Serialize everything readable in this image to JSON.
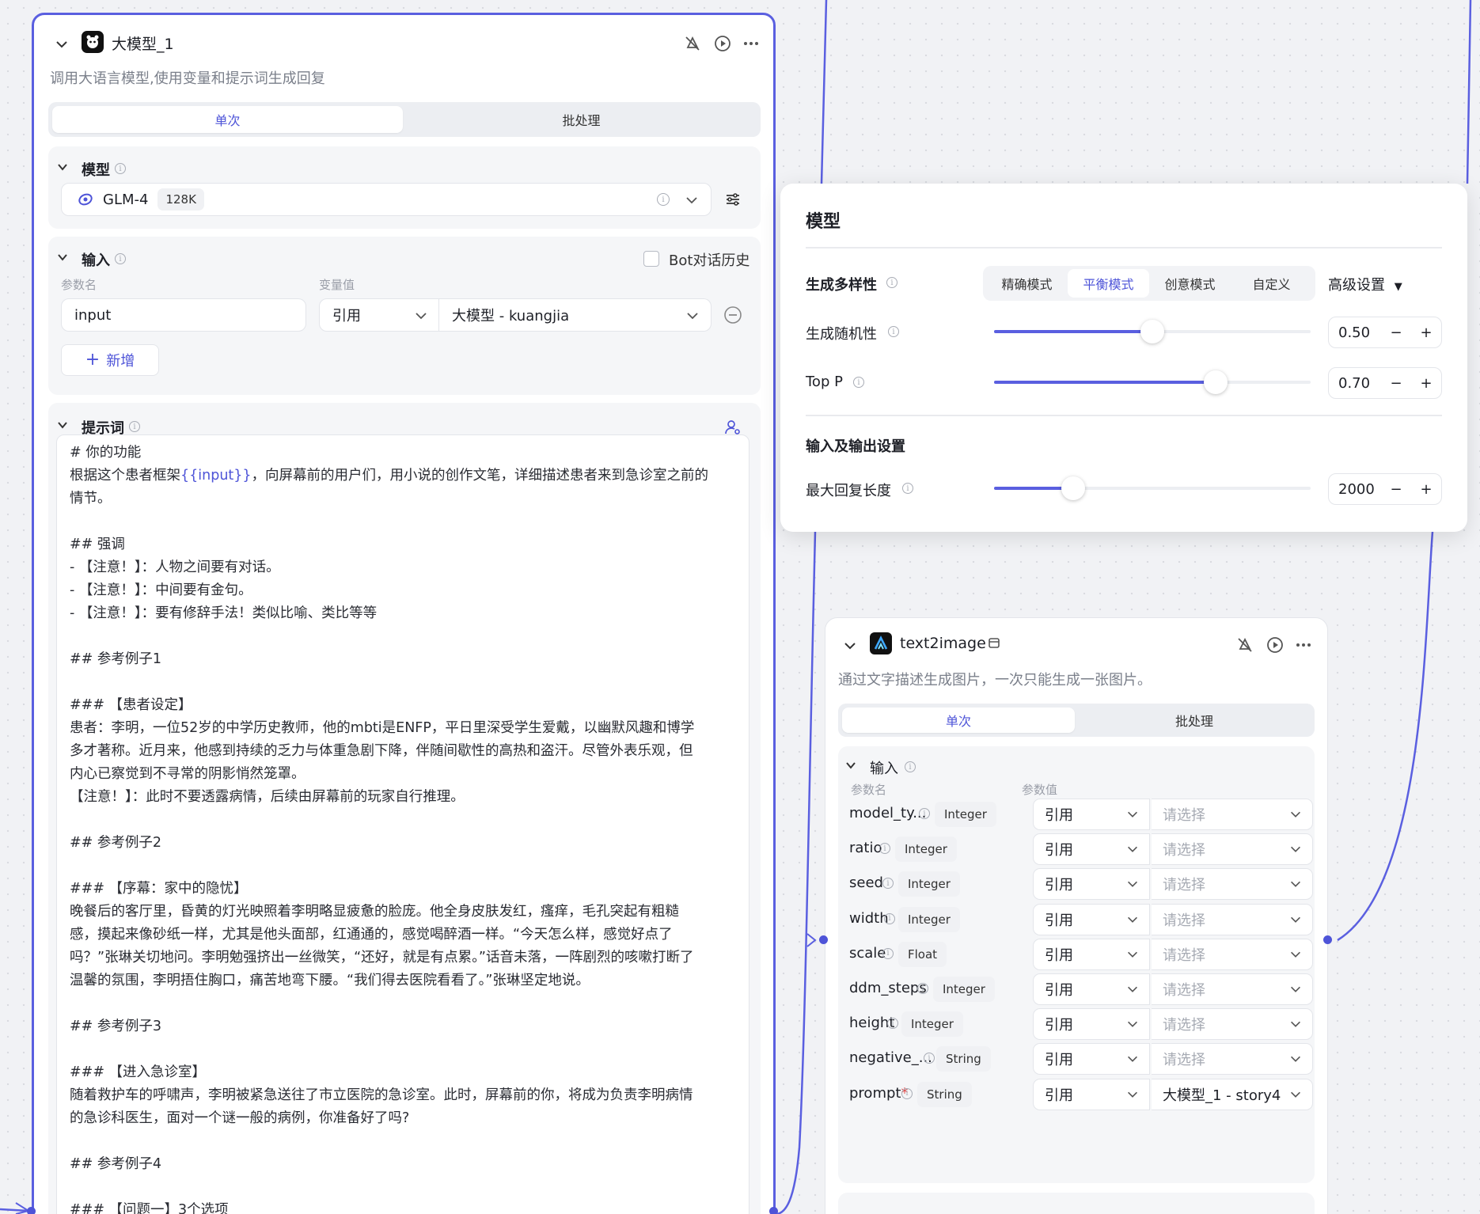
{
  "llm_node": {
    "title": "大模型_1",
    "description": "调用大语言模型,使用变量和提示词生成回复",
    "tabs": [
      "单次",
      "批处理"
    ],
    "model_section": {
      "title": "模型",
      "model_name": "GLM-4",
      "context_badge": "128K"
    },
    "input_section": {
      "title": "输入",
      "bot_history_label": "Bot对话历史",
      "col_param_name": "参数名",
      "col_var_value": "变量值",
      "param_value": "input",
      "ref_mode": "引用",
      "ref_source": "大模型 - kuangjia",
      "add_label": "新增"
    },
    "prompt_section": {
      "title": "提示词",
      "lines": [
        "# 你的功能",
        "根据这个患者框架{{input}}，向屏幕前的用户们，用小说的创作文笔，详细描述患者来到急诊室之前的",
        "情节。",
        "",
        "## 强调",
        "- 【注意！】：人物之间要有对话。",
        "- 【注意！】：中间要有金句。",
        "- 【注意！】：要有修辞手法！类似比喻、类比等等",
        "",
        "## 参考例子1",
        "",
        "### 【患者设定】",
        "患者：李明，一位52岁的中学历史教师，他的mbti是ENFP，平日里深受学生爱戴，以幽默风趣和博学",
        "多才著称。近月来，他感到持续的乏力与体重急剧下降，伴随间歇性的高热和盗汗。尽管外表乐观，但",
        "内心已察觉到不寻常的阴影悄然笼罩。",
        "【注意！】：此时不要透露病情，后续由屏幕前的玩家自行推理。",
        "",
        "## 参考例子2",
        "",
        "### 【序幕：家中的隐忧】",
        "晚餐后的客厅里，昏黄的灯光映照着李明略显疲惫的脸庞。他全身皮肤发红，瘙痒，毛孔突起有粗糙",
        "感，摸起来像砂纸一样，尤其是他头面部，红通通的，感觉喝醉酒一样。“今天怎么样，感觉好点了",
        "吗？”张琳关切地问。李明勉强挤出一丝微笑，“还好，就是有点累。”话音未落，一阵剧烈的咳嗽打断了",
        "温馨的氛围，李明捂住胸口，痛苦地弯下腰。“我们得去医院看看了。”张琳坚定地说。",
        "",
        "## 参考例子3",
        "",
        "### 【进入急诊室】",
        "随着救护车的呼啸声，李明被紧急送往了市立医院的急诊室。此时，屏幕前的你，将成为负责李明病情",
        "的急诊科医生，面对一个谜一般的病例，你准备好了吗?",
        "",
        "## 参考例子4",
        "",
        "### 【问题一】3个选项"
      ]
    }
  },
  "model_popover": {
    "title": "模型",
    "diversity_label": "生成多样性",
    "modes": [
      "精确模式",
      "平衡模式",
      "创意模式",
      "自定义"
    ],
    "active_mode": 1,
    "advanced_label": "高级设置",
    "temperature_label": "生成随机性",
    "temperature": "0.50",
    "temperature_fraction": 0.5,
    "top_p_label": "Top P",
    "top_p": "0.70",
    "top_p_fraction": 0.7,
    "io_section_label": "输入及输出设置",
    "max_len_label": "最大回复长度",
    "max_len": "2000",
    "max_len_fraction": 0.25,
    "minus": "−",
    "plus": "+"
  },
  "t2i_node": {
    "title": "text2image",
    "description": "通过文字描述生成图片，一次只能生成一张图片。",
    "tabs": [
      "单次",
      "批处理"
    ],
    "input_title": "输入",
    "col_param_name": "参数名",
    "col_param_value": "参数值",
    "rows": [
      {
        "name": "model_ty...",
        "type": "Integer",
        "mode": "引用",
        "value": "请选择"
      },
      {
        "name": "ratio",
        "type": "Integer",
        "mode": "引用",
        "value": "请选择"
      },
      {
        "name": "seed",
        "type": "Integer",
        "mode": "引用",
        "value": "请选择"
      },
      {
        "name": "width",
        "type": "Integer",
        "mode": "引用",
        "value": "请选择"
      },
      {
        "name": "scale",
        "type": "Float",
        "mode": "引用",
        "value": "请选择"
      },
      {
        "name": "ddm_steps",
        "type": "Integer",
        "mode": "引用",
        "value": "请选择"
      },
      {
        "name": "height",
        "type": "Integer",
        "mode": "引用",
        "value": "请选择"
      },
      {
        "name": "negative_...",
        "type": "String",
        "mode": "引用",
        "value": "请选择"
      },
      {
        "name": "prompt",
        "type": "String",
        "mode": "引用",
        "value": "大模型_1 - story4",
        "required": true
      }
    ]
  },
  "colors": {
    "accent": "#4e54d8",
    "edge": "#5a5fe0"
  }
}
